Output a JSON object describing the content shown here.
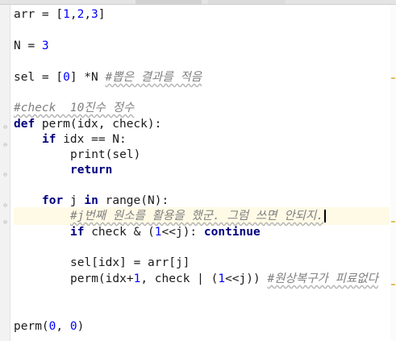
{
  "editor": {
    "lines": {
      "l1": {
        "a": "arr = [",
        "b": "1",
        "c": ",",
        "d": "2",
        "e": ",",
        "f": "3",
        "g": "]"
      },
      "l2": {
        "a": "N = ",
        "b": "3"
      },
      "l3": {
        "a": "sel = [",
        "b": "0",
        "c": "] *N ",
        "d": "#뽑은 결과를 적음"
      },
      "l4": {
        "a": "#check  10진수 정수"
      },
      "l5": {
        "a": "def",
        "b": " perm(idx, check):"
      },
      "l6": {
        "a": "if",
        "b": " idx == N:"
      },
      "l7": {
        "a": "print(sel)"
      },
      "l8": {
        "a": "return"
      },
      "l9": {
        "a": "for",
        "b": " j ",
        "c": "in",
        "d": " range(N):"
      },
      "l10": {
        "a": "#j번째 원소를 활용을 했군. 그럼 쓰면 안되지."
      },
      "l11": {
        "a": "if",
        "b": " check & (",
        "c": "1",
        "d": "<<j): ",
        "e": "continue"
      },
      "l12": {
        "a": "sel[idx] = arr[j]"
      },
      "l13": {
        "a": "perm(idx+",
        "b": "1",
        "c": ", check | (",
        "d": "1",
        "e": "<<j)) ",
        "f": "#원상복구가 피료없다"
      },
      "l14": {
        "a": "perm(",
        "b": "0",
        "c": ", ",
        "d": "0",
        "e": ")"
      }
    }
  },
  "colors": {
    "keyword": "#000080",
    "number": "#0000ff",
    "comment": "#808080",
    "current_line": "#fffae6"
  }
}
